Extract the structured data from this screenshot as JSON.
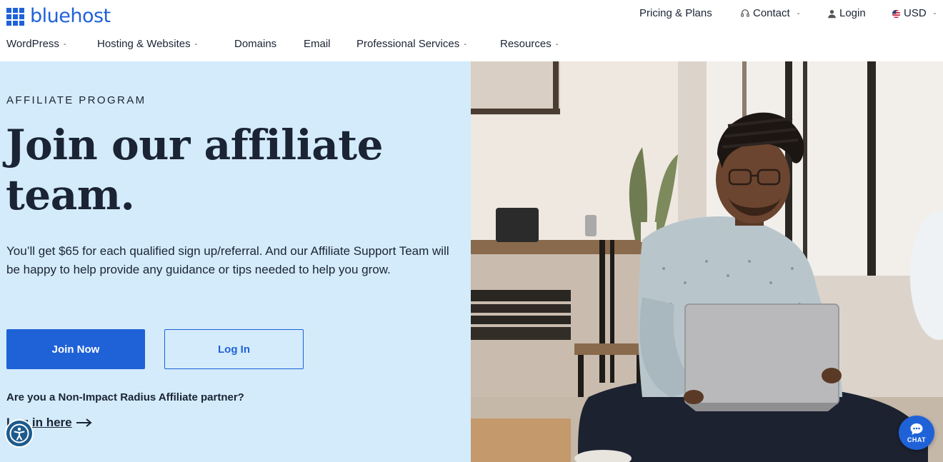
{
  "brand": {
    "name": "bluehost",
    "color": "#1f62d8"
  },
  "util_nav": {
    "pricing": "Pricing & Plans",
    "contact": "Contact",
    "login": "Login",
    "currency": "USD"
  },
  "main_nav": {
    "items": [
      "WordPress",
      "Hosting & Websites",
      "Domains",
      "Email",
      "Professional Services",
      "Resources"
    ]
  },
  "hero": {
    "eyebrow": "AFFILIATE PROGRAM",
    "headline_line1": "Join our affiliate",
    "headline_line2": "team.",
    "subtext": "You’ll get $65 for each qualified sign up/referral. And our Affiliate Support Team will be happy to help provide any guidance or tips needed to help you grow.",
    "primary_button": "Join Now",
    "secondary_button": "Log In",
    "partner_question": "Are you a Non-Impact Radius Affiliate partner?",
    "partner_link": "Log in here",
    "background_color": "#d3ebfb"
  },
  "chat": {
    "label": "CHAT"
  },
  "icons": {
    "logo": "grid-logo-icon",
    "contact": "headset-icon",
    "login": "user-icon",
    "currency": "us-flag-icon",
    "caret": "chevron-down-icon",
    "arrow": "arrow-right-icon",
    "accessibility": "accessibility-icon",
    "chat": "chat-bubble-icon"
  }
}
